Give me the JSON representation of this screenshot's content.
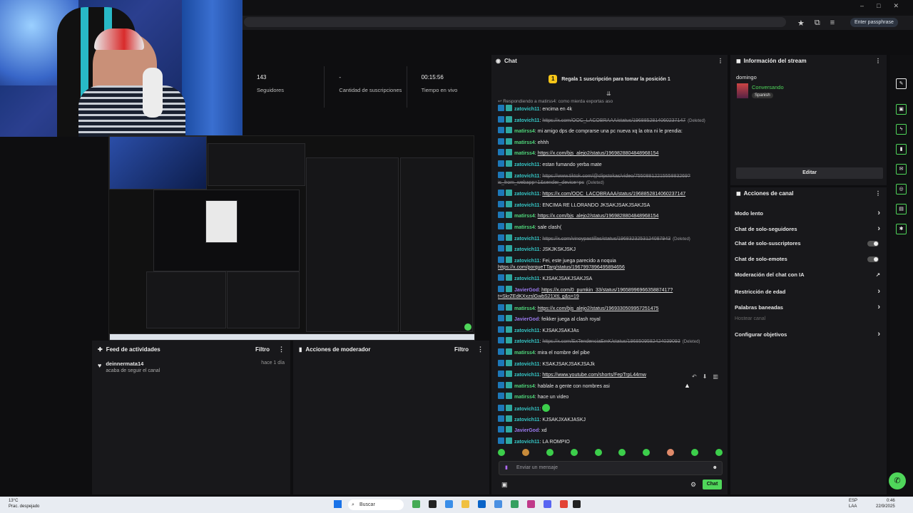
{
  "browser": {
    "passphrase_btn": "Enter passphrase",
    "window_controls": [
      "–",
      "□",
      "✕"
    ],
    "icons": [
      "★",
      "⧉",
      "≡",
      "▣"
    ]
  },
  "stats": [
    {
      "value": "143",
      "label": "Seguidores"
    },
    {
      "value": "-",
      "label": "Cantidad de suscripciones"
    },
    {
      "value": "00:15:56",
      "label": "Tiempo en vivo"
    }
  ],
  "feed": {
    "title": "Feed de actividades",
    "filter": "Filtro",
    "item": {
      "user": "deinnermata14",
      "action": "acaba de seguir el canal",
      "time": "hace 1 día"
    }
  },
  "mod": {
    "title": "Acciones de moderador",
    "filter": "Filtro"
  },
  "chat": {
    "title": "Chat",
    "gift_badge": "1",
    "gift_text": "Regala 1 suscripción para tomar la posición 1",
    "replying": "Respondiendo a matirss4: como mierda exportas aso",
    "deleted_label": "(Deleted)",
    "input_placeholder": "Enviar un mensaje",
    "send_label": "Chat"
  },
  "messages": [
    {
      "user": "zatovich11",
      "color": "cyan",
      "text": "encima en 4k"
    },
    {
      "user": "zatovich11",
      "color": "cyan",
      "text": "https://x.com/OOC_LACOBRAAA/status/1968852814060237147",
      "style": "del",
      "deleted": true
    },
    {
      "user": "matirss4",
      "color": "green",
      "text": "mi amigo dps de comprarse una pc nueva xq la otra ni le prendia:"
    },
    {
      "user": "matirss4",
      "color": "green",
      "text": "ehhh"
    },
    {
      "user": "matirss4",
      "color": "green",
      "text": "https://x.com/bjs_alejo2/status/1969828804848968154",
      "style": "lnk"
    },
    {
      "user": "zatovich11",
      "color": "cyan",
      "text": "estan fumando yerba mate"
    },
    {
      "user": "zatovich11",
      "color": "cyan",
      "text": "https://www.tiktok.com/@clipstokas/video/7550881221555883269?is_from_webapp=1&sender_device=pc",
      "style": "del",
      "deleted": true
    },
    {
      "user": "zatovich11",
      "color": "cyan",
      "text": "https://x.com/OOC_LACOBRAAA/status/1968852814060237147",
      "style": "lnk"
    },
    {
      "user": "zatovich11",
      "color": "cyan",
      "text": "ENCIMA RE LLORANDO JKSAKJSAKJSAKJSA"
    },
    {
      "user": "matirss4",
      "color": "green",
      "text": "https://x.com/bjs_alejo2/status/1969828804848968154",
      "style": "lnk"
    },
    {
      "user": "matirss4",
      "color": "green",
      "text": "sale clash("
    },
    {
      "user": "zatovich11",
      "color": "cyan",
      "text": "https://x.com/vinoypastillas/status/1968323253124087943",
      "style": "del",
      "deleted": true
    },
    {
      "user": "zatovich11",
      "color": "cyan",
      "text": "JSKJKSKJSKJ"
    },
    {
      "user": "zatovich11",
      "color": "cyan",
      "text": "Fei, este juega parecido a noquia",
      "text2": "https://x.com/porqueTTarg/status/1967997896495894656"
    },
    {
      "user": "zatovich11",
      "color": "cyan",
      "text": "KJSAKJSAKJSAKJSA"
    },
    {
      "user": "JavierGod",
      "color": "purple",
      "text": "https://x.com/0_pumkin_33/status/1965899696635887417?",
      "style": "lnk",
      "text2": "t=SkrZEdKXxzslGwbS21XtL g&s=19"
    },
    {
      "user": "matirss4",
      "color": "green",
      "text": "https://x.com/bjs_alejo2/status/1969330509957251475",
      "style": "lnk"
    },
    {
      "user": "JavierGod",
      "color": "purple",
      "text": "feikker juega al clash royal"
    },
    {
      "user": "zatovich11",
      "color": "cyan",
      "text": "KJSAKJSAKJAs"
    },
    {
      "user": "zatovich11",
      "color": "cyan",
      "text": "https://x.com/ExTendenciaEmK/status/1968509582424039093",
      "style": "del",
      "deleted": true
    },
    {
      "user": "matirss4",
      "color": "green",
      "text": "mira el nombre del pibe"
    },
    {
      "user": "zatovich11",
      "color": "cyan",
      "text": "KSAKJSAKJSAKJSAJk"
    },
    {
      "user": "zatovich11",
      "color": "cyan",
      "text": "https://www.youtube.com/shorts/FepTrpL44mw",
      "style": "lnk"
    },
    {
      "user": "matirss4",
      "color": "green",
      "text": "hablale a gente con nombres asi"
    },
    {
      "user": "matirss4",
      "color": "green",
      "text": "hace un video"
    },
    {
      "user": "zatovich11",
      "color": "cyan",
      "text": "",
      "emote": true
    },
    {
      "user": "zatovich11",
      "color": "cyan",
      "text": "KJSAKJXAKJASKJ"
    },
    {
      "user": "JavierGod",
      "color": "purple",
      "text": "xd"
    },
    {
      "user": "zatovich11",
      "color": "cyan",
      "text": "LA ROMPIO"
    }
  ],
  "info": {
    "title": "Información del stream",
    "stream_title": "domingo",
    "category": "Conversando",
    "language": "Spanish",
    "edit": "Editar"
  },
  "acciones": {
    "title": "Acciones de canal",
    "items": [
      {
        "label": "Modo lento",
        "kind": "chev"
      },
      {
        "label": "Chat de solo-seguidores",
        "kind": "chev"
      },
      {
        "label": "Chat de solo-suscriptores",
        "kind": "toggle"
      },
      {
        "label": "Chat de solo-emotes",
        "kind": "toggle"
      },
      {
        "label": "Moderación del chat con IA",
        "kind": "ext"
      },
      {
        "label": "Restricción de edad",
        "kind": "chev"
      },
      {
        "label": "Palabras baneadas",
        "kind": "chev"
      },
      {
        "label": "Hostear canal",
        "kind": "disabled"
      },
      {
        "label": "Configurar objetivos",
        "kind": "chev"
      }
    ]
  },
  "taskbar": {
    "weather_temp": "13°C",
    "weather_desc": "Prac. despejado",
    "search": "Buscar",
    "lang1": "ESP",
    "lang2": "LAA",
    "time": "0:46",
    "date": "22/9/2025"
  },
  "colors": {
    "accent": "#4fd65a",
    "user_green": "#4fd67a",
    "user_cyan": "#35c6c6",
    "user_purple": "#9b7bf0"
  }
}
